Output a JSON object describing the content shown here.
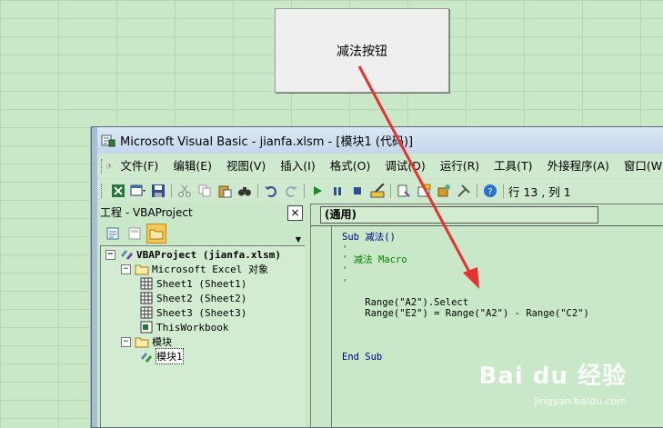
{
  "sheet_button": {
    "label": "减法按钮"
  },
  "window": {
    "title": "Microsoft Visual Basic - jianfa.xlsm - [模块1 (代码)]"
  },
  "menu": [
    {
      "label": "文件(F)"
    },
    {
      "label": "编辑(E)"
    },
    {
      "label": "视图(V)"
    },
    {
      "label": "插入(I)"
    },
    {
      "label": "格式(O)"
    },
    {
      "label": "调试(D)"
    },
    {
      "label": "运行(R)"
    },
    {
      "label": "工具(T)"
    },
    {
      "label": "外接程序(A)"
    },
    {
      "label": "窗口(W)"
    }
  ],
  "toolbar": {
    "cursor_position": "行 13 , 列 1"
  },
  "project_pane": {
    "title": "工程 - VBAProject",
    "close": "×",
    "tree": [
      {
        "label": "VBAProject (jianfa.xlsm)",
        "expander": "−"
      },
      {
        "label": "Microsoft Excel 对象",
        "expander": "−"
      },
      {
        "label": "Sheet1 (Sheet1)"
      },
      {
        "label": "Sheet2 (Sheet2)"
      },
      {
        "label": "Sheet3 (Sheet3)"
      },
      {
        "label": "ThisWorkbook"
      },
      {
        "label": "模块",
        "expander": "−"
      },
      {
        "label": "模块1"
      }
    ]
  },
  "code_pane": {
    "object_selector": "(通用)",
    "lines": [
      {
        "text": "Sub 减法()"
      },
      {
        "text": "'"
      },
      {
        "text": "' 减法 Macro"
      },
      {
        "text": "'"
      },
      {
        "text": ""
      },
      {
        "text": "'"
      },
      {
        "text": "    Range(\"A2\").Select"
      },
      {
        "text": "    Range(\"E2\") = Range(\"A2\") - Range(\"C2\")"
      },
      {
        "text": ""
      },
      {
        "text": ""
      },
      {
        "text": ""
      },
      {
        "text": "End Sub"
      }
    ]
  },
  "watermark": {
    "brand": "Bai du 经验",
    "url": "jingyan.baidu.com"
  },
  "colors": {
    "annotation_arrow": "#e8322e",
    "keyword": "#00008b",
    "comment": "#008000"
  }
}
